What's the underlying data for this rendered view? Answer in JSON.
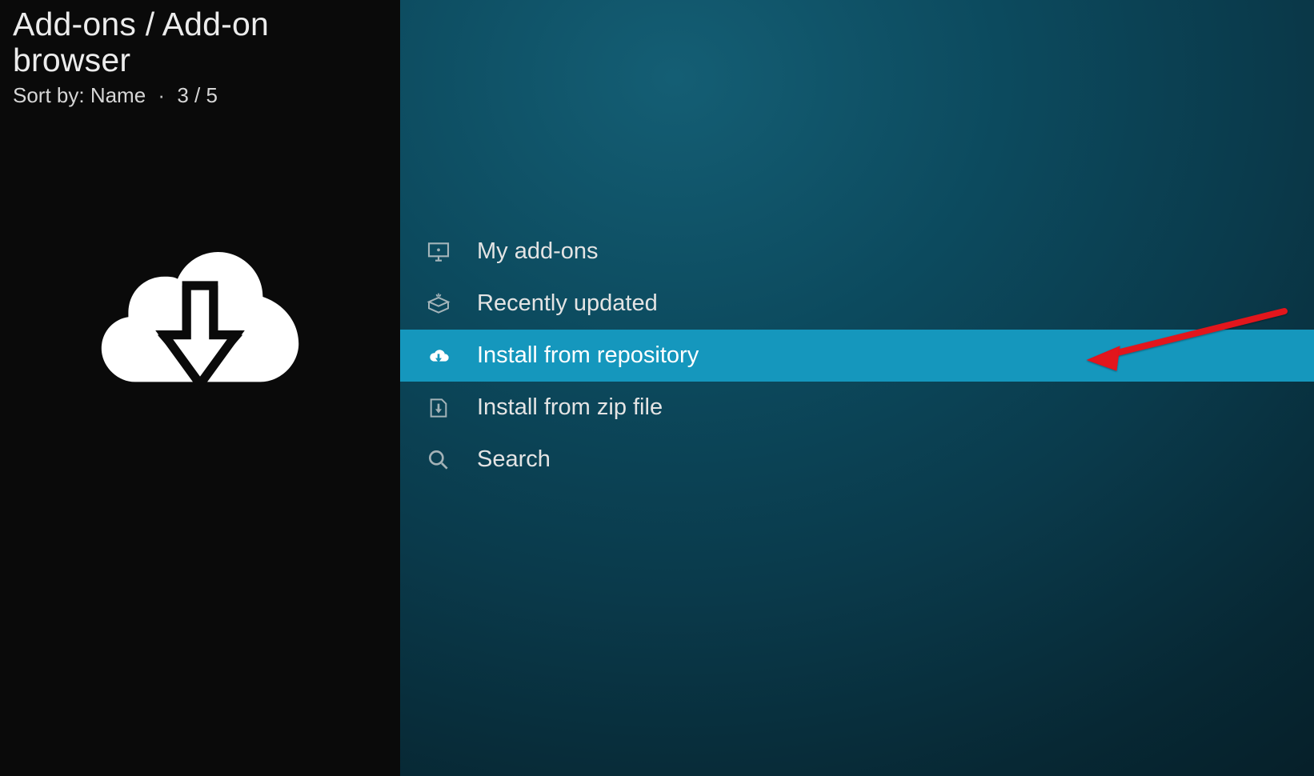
{
  "breadcrumb": "Add-ons / Add-on browser",
  "sort": {
    "label": "Sort by: Name",
    "separator": "·",
    "index": "3 / 5"
  },
  "menu": {
    "items": [
      {
        "label": "My add-ons",
        "icon": "monitor-icon"
      },
      {
        "label": "Recently updated",
        "icon": "box-open-icon"
      },
      {
        "label": "Install from repository",
        "icon": "cloud-download-icon"
      },
      {
        "label": "Install from zip file",
        "icon": "zip-download-icon"
      },
      {
        "label": "Search",
        "icon": "search-icon"
      }
    ],
    "selected_index": 2
  },
  "annotation": {
    "arrow_color": "#e2121b"
  }
}
